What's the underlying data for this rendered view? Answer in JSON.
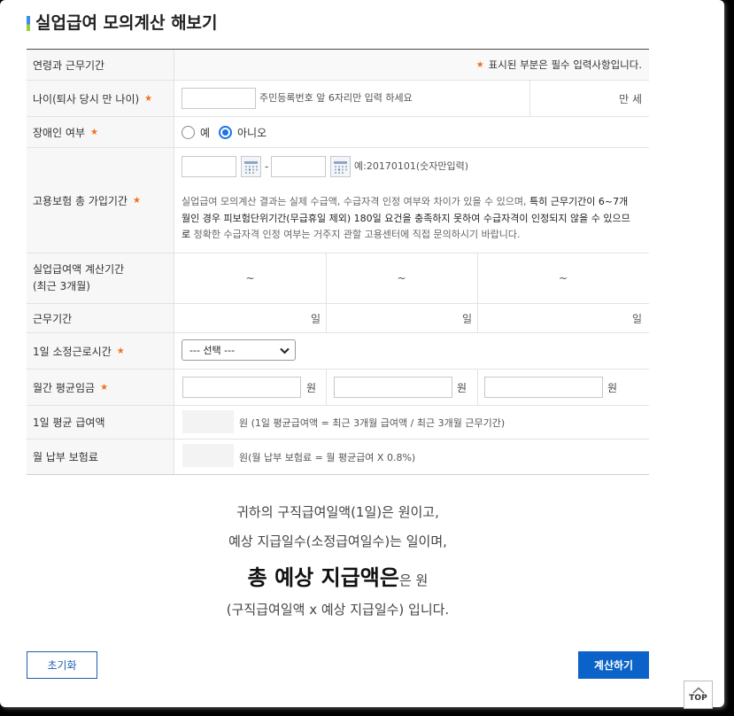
{
  "title": "실업급여 모의계산 해보기",
  "colors": {
    "accent": "#0b63c9",
    "required_star": "#f07020",
    "radio_checked": "#1a73e8",
    "outline_button": "#1c5fb0"
  },
  "icons": {
    "calendar": "calendar-icon",
    "select": "chevron-down-icon",
    "top": "chevron-up-icon"
  },
  "form": {
    "star": "★",
    "section_label": "연령과 근무기간",
    "required_note": "표시된 부분은 필수 입력사항입니다.",
    "age": {
      "label": "나이(퇴사 당시 만 나이)",
      "hint": "주민등록번호 앞 6자리만 입력 하세요",
      "unit": "만 세"
    },
    "disability": {
      "label": "장애인 여부",
      "options": [
        {
          "label": "예",
          "checked": false
        },
        {
          "label": "아니오",
          "checked": true
        }
      ]
    },
    "insurance_period": {
      "label": "고용보험 총 가입기간",
      "separator": "-",
      "example": "예:20170101(숫자만입력)",
      "notice": [
        {
          "normal": "실업급여 모의계산 결과는 실제 수급액, 수급자격 인정 여부와 차이가 있을 수 있으며, ",
          "strong": "특히 근무기간이 6~7개"
        },
        {
          "strong": "월인 경우 피보험단위기간(무급휴일 제외) 180일 요건을 충족하지 못하여 수급자격이 인정되지 않을 수 있으므"
        },
        {
          "strong": "로",
          "normal": " 정확한 수급자격 인정 여부는 거주지 관할 고용센터에 직접 문의하시기 바랍니다."
        }
      ]
    },
    "calc_period": {
      "label_line1": "실업급여액 계산기간",
      "label_line2": "(최근 3개월)",
      "range_mark": "~"
    },
    "work_days": {
      "label": "근무기간",
      "unit": "일"
    },
    "daily_hours": {
      "label": "1일 소정근로시간",
      "selected": "--- 선택 ---"
    },
    "monthly_wage": {
      "label": "월간 평균임금",
      "unit": "원"
    },
    "daily_avg": {
      "label": "1일 평균 급여액",
      "desc": "원 (1일 평균급여액 = 최근 3개월 급여액 / 최근 3개월 근무기간)"
    },
    "monthly_premium": {
      "label": "월 납부 보험료",
      "desc": "원(월 납부 보험료 = 월 평균급여 X 0.8%)"
    }
  },
  "result": {
    "line1": "귀하의 구직급여일액(1일)은 원이고,",
    "line2": "예상 지급일수(소정급여일수)는 일이며,",
    "total_label": "총 예상 지급액은",
    "total_suffix": "은 원",
    "line4": "(구직급여일액 x 예상 지급일수) 입니다."
  },
  "buttons": {
    "reset": "초기화",
    "calculate": "계산하기",
    "top": "TOP"
  }
}
